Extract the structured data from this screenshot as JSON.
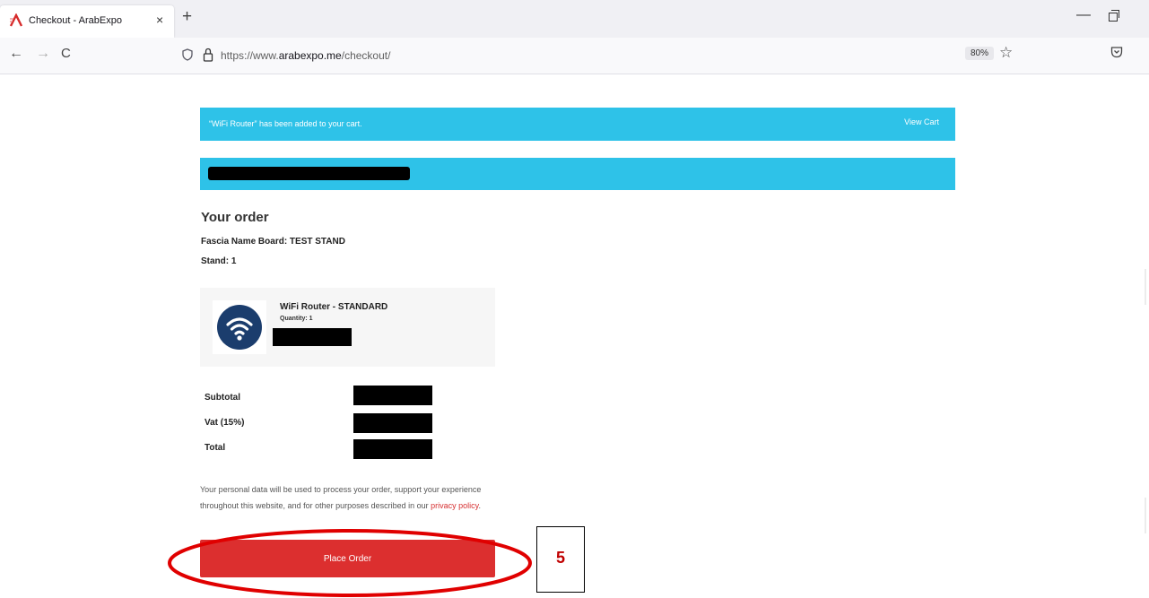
{
  "browser": {
    "tab_title": "Checkout - ArabExpo",
    "tab_close": "×",
    "new_tab": "+",
    "window_min": "—",
    "back": "←",
    "forward": "→",
    "reload": "C",
    "url_prefix": "https://www.",
    "url_domain": "arabexpo.me",
    "url_path": "/checkout/",
    "zoom": "80%"
  },
  "notice": {
    "message": "“WiFi Router” has been added to your cart.",
    "link": "View Cart"
  },
  "order": {
    "heading": "Your order",
    "fascia": "Fascia Name Board: TEST STAND",
    "stand": "Stand: 1"
  },
  "product": {
    "name": "WiFi Router - STANDARD",
    "quantity": "Quantity: 1"
  },
  "totals": {
    "subtotal_label": "Subtotal",
    "vat_label": "Vat (15%)",
    "total_label": "Total"
  },
  "privacy": {
    "text": "Your personal data will be used to process your order, support your experience throughout this website, and for other purposes described in our ",
    "link": "privacy policy",
    "suffix": "."
  },
  "place_order_label": "Place Order",
  "annotation": {
    "step": "5"
  },
  "colors": {
    "banner": "#2ec2e8",
    "button": "#dc2f2f",
    "annotation": "#e00000"
  }
}
